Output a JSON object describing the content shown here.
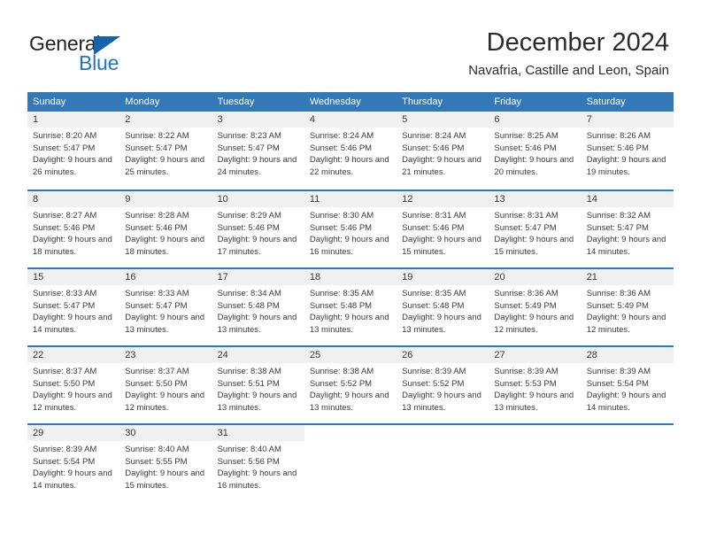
{
  "brand": {
    "name_part1": "General",
    "name_part2": "Blue",
    "triangle_color": "#1464aa",
    "blue_color": "#1f74c4"
  },
  "header": {
    "title": "December 2024",
    "subtitle": "Navafria, Castille and Leon, Spain"
  },
  "theme": {
    "header_blue": "#3379b7",
    "day_band_gray": "#f0f0f0",
    "text_color": "#3a3a3a"
  },
  "weekdays": [
    "Sunday",
    "Monday",
    "Tuesday",
    "Wednesday",
    "Thursday",
    "Friday",
    "Saturday"
  ],
  "weeks": [
    [
      {
        "day": "1",
        "sunrise": "Sunrise: 8:20 AM",
        "sunset": "Sunset: 5:47 PM",
        "daylight": "Daylight: 9 hours and 26 minutes."
      },
      {
        "day": "2",
        "sunrise": "Sunrise: 8:22 AM",
        "sunset": "Sunset: 5:47 PM",
        "daylight": "Daylight: 9 hours and 25 minutes."
      },
      {
        "day": "3",
        "sunrise": "Sunrise: 8:23 AM",
        "sunset": "Sunset: 5:47 PM",
        "daylight": "Daylight: 9 hours and 24 minutes."
      },
      {
        "day": "4",
        "sunrise": "Sunrise: 8:24 AM",
        "sunset": "Sunset: 5:46 PM",
        "daylight": "Daylight: 9 hours and 22 minutes."
      },
      {
        "day": "5",
        "sunrise": "Sunrise: 8:24 AM",
        "sunset": "Sunset: 5:46 PM",
        "daylight": "Daylight: 9 hours and 21 minutes."
      },
      {
        "day": "6",
        "sunrise": "Sunrise: 8:25 AM",
        "sunset": "Sunset: 5:46 PM",
        "daylight": "Daylight: 9 hours and 20 minutes."
      },
      {
        "day": "7",
        "sunrise": "Sunrise: 8:26 AM",
        "sunset": "Sunset: 5:46 PM",
        "daylight": "Daylight: 9 hours and 19 minutes."
      }
    ],
    [
      {
        "day": "8",
        "sunrise": "Sunrise: 8:27 AM",
        "sunset": "Sunset: 5:46 PM",
        "daylight": "Daylight: 9 hours and 18 minutes."
      },
      {
        "day": "9",
        "sunrise": "Sunrise: 8:28 AM",
        "sunset": "Sunset: 5:46 PM",
        "daylight": "Daylight: 9 hours and 18 minutes."
      },
      {
        "day": "10",
        "sunrise": "Sunrise: 8:29 AM",
        "sunset": "Sunset: 5:46 PM",
        "daylight": "Daylight: 9 hours and 17 minutes."
      },
      {
        "day": "11",
        "sunrise": "Sunrise: 8:30 AM",
        "sunset": "Sunset: 5:46 PM",
        "daylight": "Daylight: 9 hours and 16 minutes."
      },
      {
        "day": "12",
        "sunrise": "Sunrise: 8:31 AM",
        "sunset": "Sunset: 5:46 PM",
        "daylight": "Daylight: 9 hours and 15 minutes."
      },
      {
        "day": "13",
        "sunrise": "Sunrise: 8:31 AM",
        "sunset": "Sunset: 5:47 PM",
        "daylight": "Daylight: 9 hours and 15 minutes."
      },
      {
        "day": "14",
        "sunrise": "Sunrise: 8:32 AM",
        "sunset": "Sunset: 5:47 PM",
        "daylight": "Daylight: 9 hours and 14 minutes."
      }
    ],
    [
      {
        "day": "15",
        "sunrise": "Sunrise: 8:33 AM",
        "sunset": "Sunset: 5:47 PM",
        "daylight": "Daylight: 9 hours and 14 minutes."
      },
      {
        "day": "16",
        "sunrise": "Sunrise: 8:33 AM",
        "sunset": "Sunset: 5:47 PM",
        "daylight": "Daylight: 9 hours and 13 minutes."
      },
      {
        "day": "17",
        "sunrise": "Sunrise: 8:34 AM",
        "sunset": "Sunset: 5:48 PM",
        "daylight": "Daylight: 9 hours and 13 minutes."
      },
      {
        "day": "18",
        "sunrise": "Sunrise: 8:35 AM",
        "sunset": "Sunset: 5:48 PM",
        "daylight": "Daylight: 9 hours and 13 minutes."
      },
      {
        "day": "19",
        "sunrise": "Sunrise: 8:35 AM",
        "sunset": "Sunset: 5:48 PM",
        "daylight": "Daylight: 9 hours and 13 minutes."
      },
      {
        "day": "20",
        "sunrise": "Sunrise: 8:36 AM",
        "sunset": "Sunset: 5:49 PM",
        "daylight": "Daylight: 9 hours and 12 minutes."
      },
      {
        "day": "21",
        "sunrise": "Sunrise: 8:36 AM",
        "sunset": "Sunset: 5:49 PM",
        "daylight": "Daylight: 9 hours and 12 minutes."
      }
    ],
    [
      {
        "day": "22",
        "sunrise": "Sunrise: 8:37 AM",
        "sunset": "Sunset: 5:50 PM",
        "daylight": "Daylight: 9 hours and 12 minutes."
      },
      {
        "day": "23",
        "sunrise": "Sunrise: 8:37 AM",
        "sunset": "Sunset: 5:50 PM",
        "daylight": "Daylight: 9 hours and 12 minutes."
      },
      {
        "day": "24",
        "sunrise": "Sunrise: 8:38 AM",
        "sunset": "Sunset: 5:51 PM",
        "daylight": "Daylight: 9 hours and 13 minutes."
      },
      {
        "day": "25",
        "sunrise": "Sunrise: 8:38 AM",
        "sunset": "Sunset: 5:52 PM",
        "daylight": "Daylight: 9 hours and 13 minutes."
      },
      {
        "day": "26",
        "sunrise": "Sunrise: 8:39 AM",
        "sunset": "Sunset: 5:52 PM",
        "daylight": "Daylight: 9 hours and 13 minutes."
      },
      {
        "day": "27",
        "sunrise": "Sunrise: 8:39 AM",
        "sunset": "Sunset: 5:53 PM",
        "daylight": "Daylight: 9 hours and 13 minutes."
      },
      {
        "day": "28",
        "sunrise": "Sunrise: 8:39 AM",
        "sunset": "Sunset: 5:54 PM",
        "daylight": "Daylight: 9 hours and 14 minutes."
      }
    ],
    [
      {
        "day": "29",
        "sunrise": "Sunrise: 8:39 AM",
        "sunset": "Sunset: 5:54 PM",
        "daylight": "Daylight: 9 hours and 14 minutes."
      },
      {
        "day": "30",
        "sunrise": "Sunrise: 8:40 AM",
        "sunset": "Sunset: 5:55 PM",
        "daylight": "Daylight: 9 hours and 15 minutes."
      },
      {
        "day": "31",
        "sunrise": "Sunrise: 8:40 AM",
        "sunset": "Sunset: 5:56 PM",
        "daylight": "Daylight: 9 hours and 16 minutes."
      },
      {
        "day": "",
        "sunrise": "",
        "sunset": "",
        "daylight": ""
      },
      {
        "day": "",
        "sunrise": "",
        "sunset": "",
        "daylight": ""
      },
      {
        "day": "",
        "sunrise": "",
        "sunset": "",
        "daylight": ""
      },
      {
        "day": "",
        "sunrise": "",
        "sunset": "",
        "daylight": ""
      }
    ]
  ]
}
